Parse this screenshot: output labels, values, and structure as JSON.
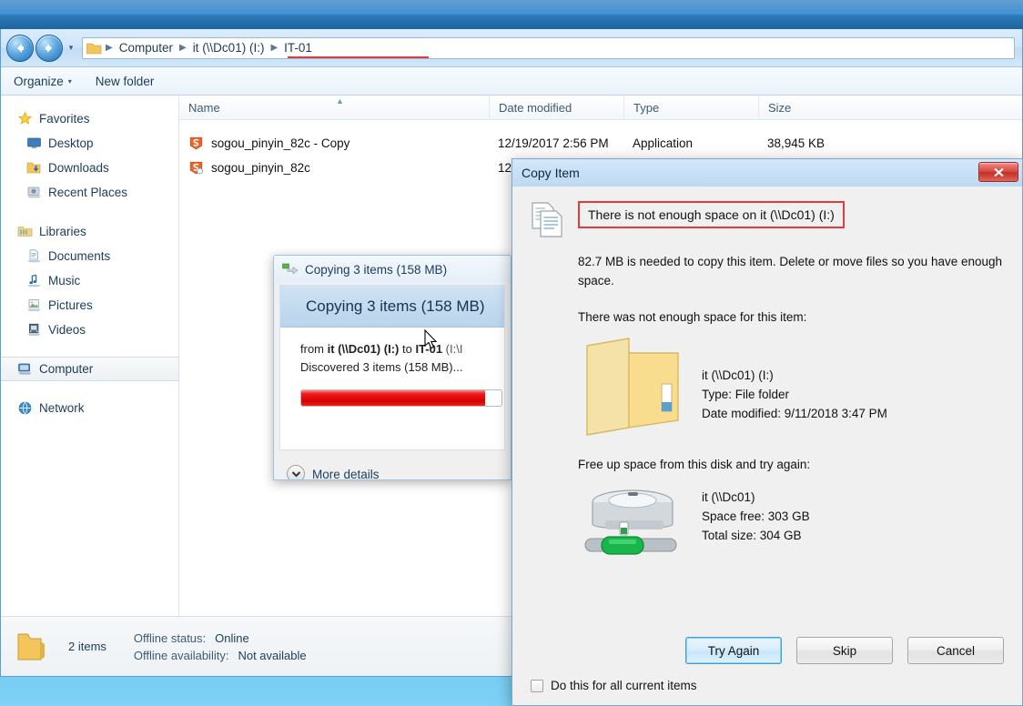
{
  "explorer": {
    "nav": {
      "back_icon": "back-arrow-icon",
      "forward_icon": "forward-arrow-icon",
      "history_caret": "▾",
      "breadcrumbs": [
        "Computer",
        "it (\\\\Dc01) (I:)",
        "IT-01"
      ],
      "separator": "▶"
    },
    "toolbar": {
      "organize_label": "Organize",
      "organize_caret": "▾",
      "new_folder_label": "New folder"
    },
    "sidebar": {
      "groups": [
        {
          "header": "Favorites",
          "icon": "star-icon",
          "items": [
            {
              "label": "Desktop",
              "icon": "desktop-icon"
            },
            {
              "label": "Downloads",
              "icon": "downloads-icon"
            },
            {
              "label": "Recent Places",
              "icon": "recent-places-icon"
            }
          ]
        },
        {
          "header": "Libraries",
          "icon": "libraries-icon",
          "items": [
            {
              "label": "Documents",
              "icon": "documents-icon"
            },
            {
              "label": "Music",
              "icon": "music-icon"
            },
            {
              "label": "Pictures",
              "icon": "pictures-icon"
            },
            {
              "label": "Videos",
              "icon": "videos-icon"
            }
          ]
        }
      ],
      "computer": {
        "label": "Computer",
        "icon": "computer-icon",
        "selected": true
      },
      "network": {
        "label": "Network",
        "icon": "network-icon"
      }
    },
    "columns": [
      "Name",
      "Date modified",
      "Type",
      "Size"
    ],
    "rows": [
      {
        "name": "sogou_pinyin_82c - Copy",
        "date": "12/19/2017 2:56 PM",
        "type": "Application",
        "size": "38,945 KB",
        "icon": "sogou-app-icon"
      },
      {
        "name": "sogou_pinyin_82c",
        "date": "12",
        "type": "",
        "size": "",
        "icon": "sogou-app-icon"
      }
    ],
    "status": {
      "item_count": "2 items",
      "offline_status_label": "Offline status:",
      "offline_status_value": "Online",
      "offline_avail_label": "Offline availability:",
      "offline_avail_value": "Not available",
      "folder_icon": "folder-icon"
    }
  },
  "copy_progress": {
    "title": "Copying 3 items (158 MB)",
    "title_icon": "copy-items-icon",
    "heading": "Copying 3 items (158 MB)",
    "from_prefix": "from ",
    "source": "it (\\\\Dc01) (I:)",
    "to_word": " to ",
    "destination": "IT-01",
    "destination_path": " (I:\\I",
    "discovered": "Discovered 3 items (158 MB)...",
    "progress_percent": 92,
    "progress_color": "#d40000",
    "more_details_label": "More details",
    "more_details_icon": "chevron-down-icon",
    "cursor_icon": "mouse-cursor-icon"
  },
  "copy_item_dialog": {
    "title": "Copy Item",
    "close_label": "✕",
    "doc_icon": "document-pages-icon",
    "error_headline": "There is not enough space on it (\\\\Dc01) (I:)",
    "error_highlight_color": "#e03c3c",
    "error_detail": "82.7 MB is needed to copy this item. Delete or move files so you have enough space.",
    "item_section_label": "There was not enough space for this item:",
    "item": {
      "icon": "folder-icon",
      "name": "it (\\\\Dc01) (I:)",
      "type_line": "Type: File folder",
      "date_line": "Date modified: 9/11/2018 3:47 PM"
    },
    "disk_section_label": "Free up space from this disk and try again:",
    "disk": {
      "icon": "network-drive-icon",
      "name": "it (\\\\Dc01)",
      "space_free": "Space free: 303 GB",
      "total_size": "Total size: 304 GB"
    },
    "buttons": {
      "try_again": "Try Again",
      "skip": "Skip",
      "cancel": "Cancel"
    },
    "checkbox_label": "Do this for all current items",
    "checkbox_checked": false
  }
}
